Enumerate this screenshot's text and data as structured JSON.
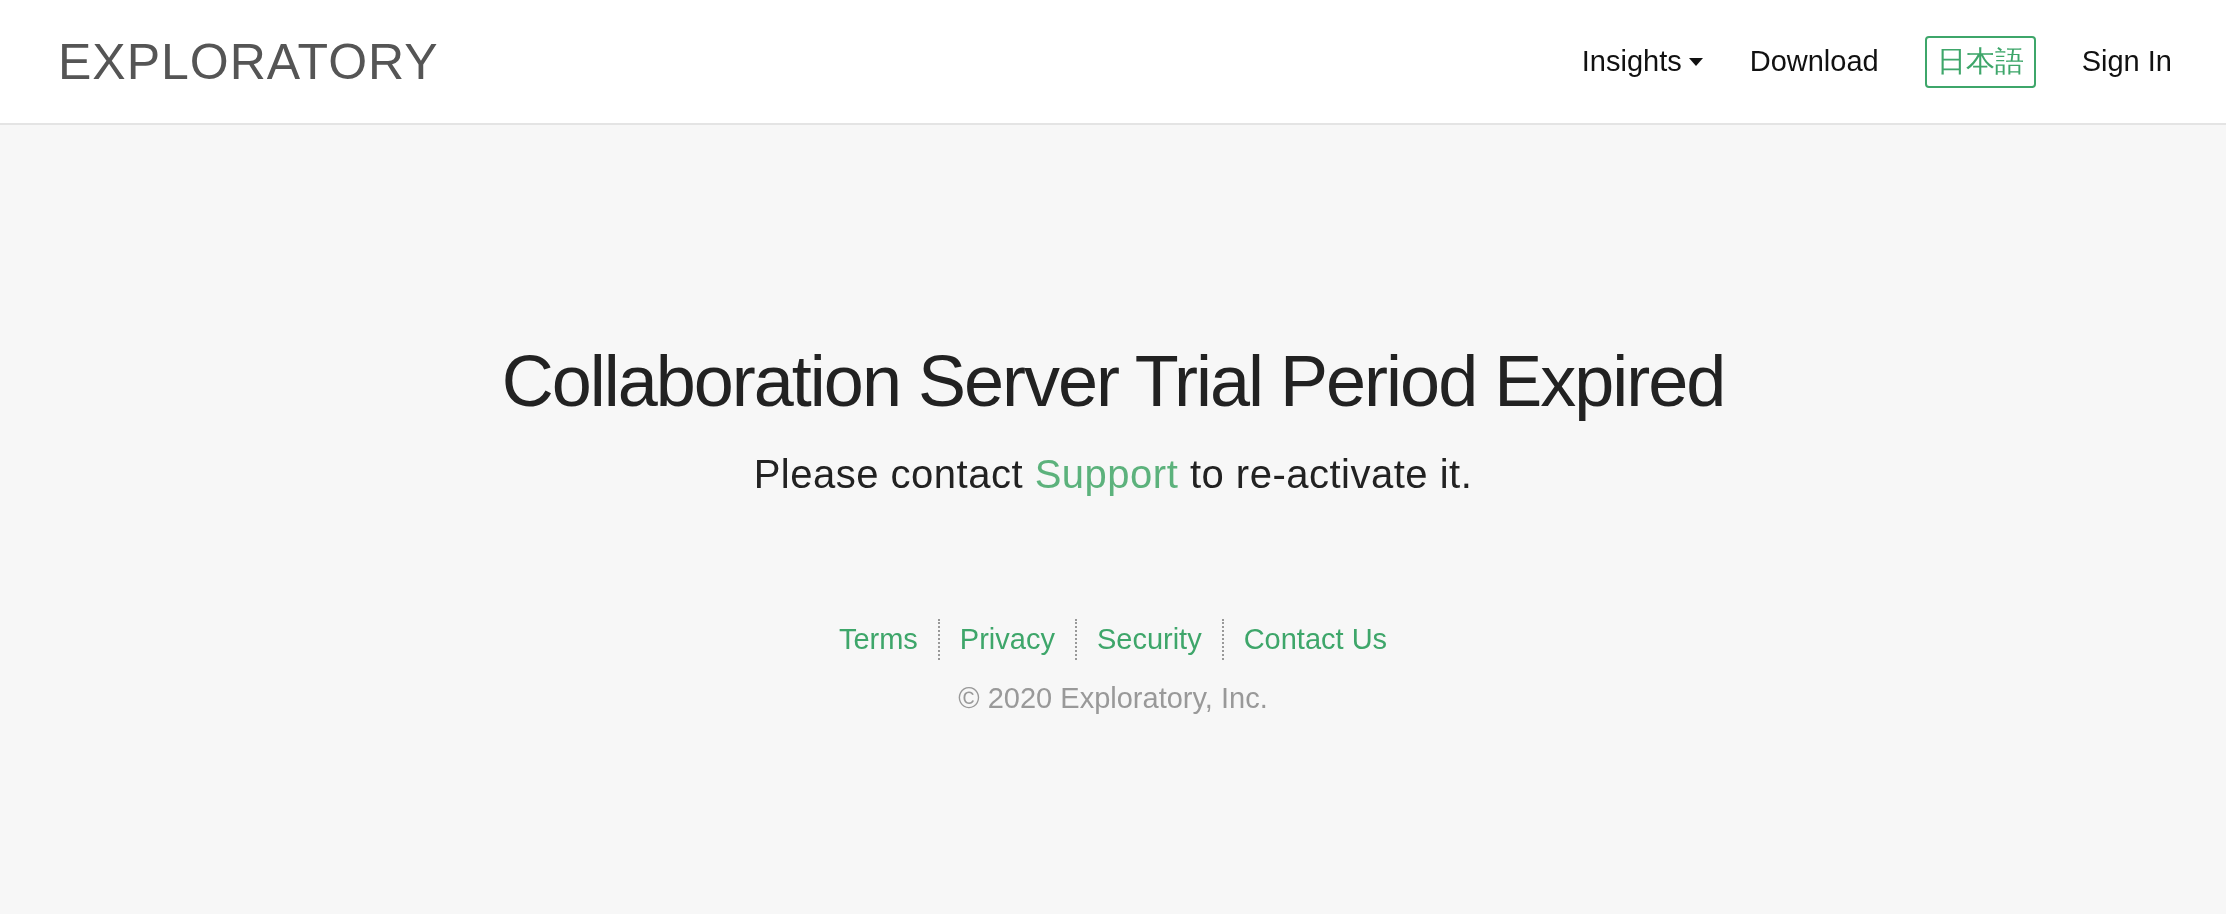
{
  "header": {
    "logo": "EXPLORATORY",
    "nav": [
      {
        "label": "Insights",
        "kind": "dropdown"
      },
      {
        "label": "Download",
        "kind": "link"
      },
      {
        "label": "日本語",
        "kind": "outlined"
      },
      {
        "label": "Sign In",
        "kind": "link"
      }
    ]
  },
  "main": {
    "title": "Collaboration Server Trial Period Expired",
    "message_before": "Please contact ",
    "message_link": "Support",
    "message_after": " to re-activate it."
  },
  "footer": {
    "links": [
      "Terms",
      "Privacy",
      "Security",
      "Contact Us"
    ],
    "copyright": "© 2020 Exploratory, Inc."
  }
}
